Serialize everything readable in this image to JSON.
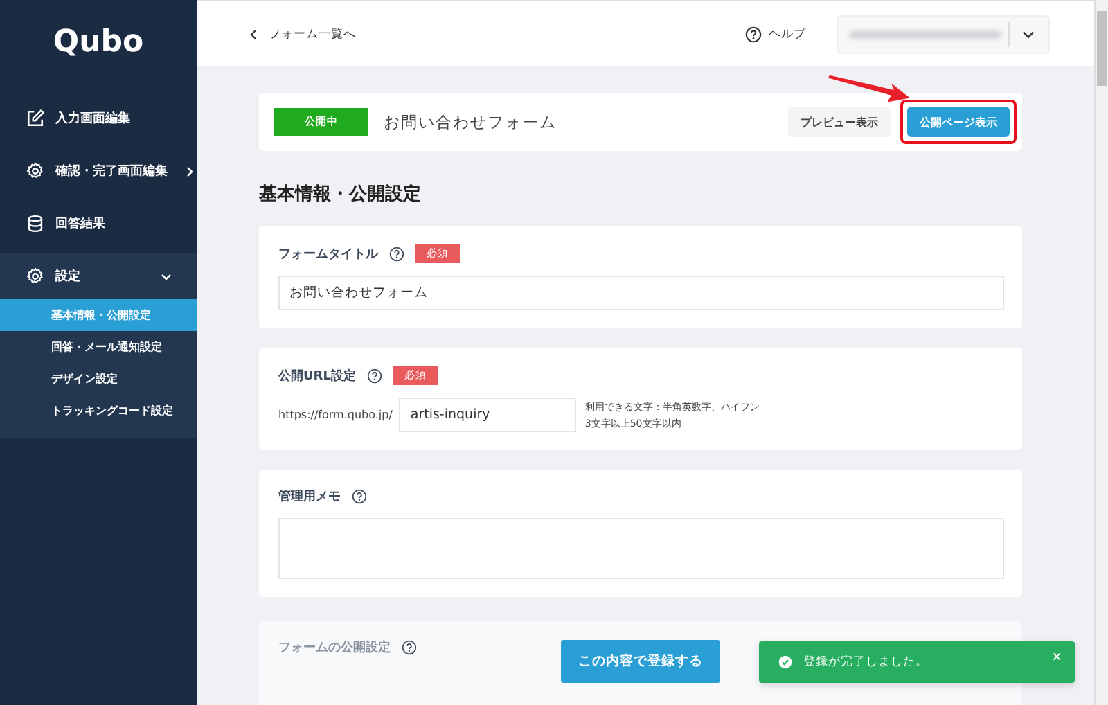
{
  "sidebar": {
    "logo": "Qubo",
    "items": [
      {
        "label": "入力画面編集",
        "kind": "link"
      },
      {
        "label": "確認・完了画面編集",
        "kind": "group",
        "expanded": false
      },
      {
        "label": "回答結果",
        "kind": "link"
      },
      {
        "label": "設定",
        "kind": "group",
        "expanded": true,
        "children": [
          {
            "label": "基本情報・公開設定",
            "selected": true
          },
          {
            "label": "回答・メール通知設定",
            "selected": false
          },
          {
            "label": "デザイン設定",
            "selected": false
          },
          {
            "label": "トラッキングコード設定",
            "selected": false
          }
        ]
      }
    ]
  },
  "topbar": {
    "back_link": "フォーム一覧へ",
    "help": "ヘルプ"
  },
  "header": {
    "status_badge": "公開中",
    "form_name": "お問い合わせフォーム",
    "buttons": [
      {
        "label": "プレビュー表示",
        "kind": "secondary",
        "annotated": false
      },
      {
        "label": "公開ページ表示",
        "kind": "primary",
        "annotated": true
      }
    ]
  },
  "section_title": "基本情報・公開設定",
  "cards": [
    {
      "kind": "text",
      "label": "フォームタイトル",
      "required": "必須",
      "value": "お問い合わせフォーム"
    },
    {
      "kind": "url",
      "label": "公開URL設定",
      "required": "必須",
      "prefix": "https://form.qubo.jp/",
      "value": "artis-inquiry",
      "hints": [
        "利用できる文字：半角英数字、ハイフン",
        "3文字以上50文字以内"
      ]
    },
    {
      "kind": "textarea",
      "label": "管理用メモ"
    },
    {
      "kind": "options",
      "label": "フォームの公開設定",
      "faded": true
    }
  ],
  "submit_button": "この内容で登録する",
  "toast": {
    "message": "登録が完了しました。"
  }
}
